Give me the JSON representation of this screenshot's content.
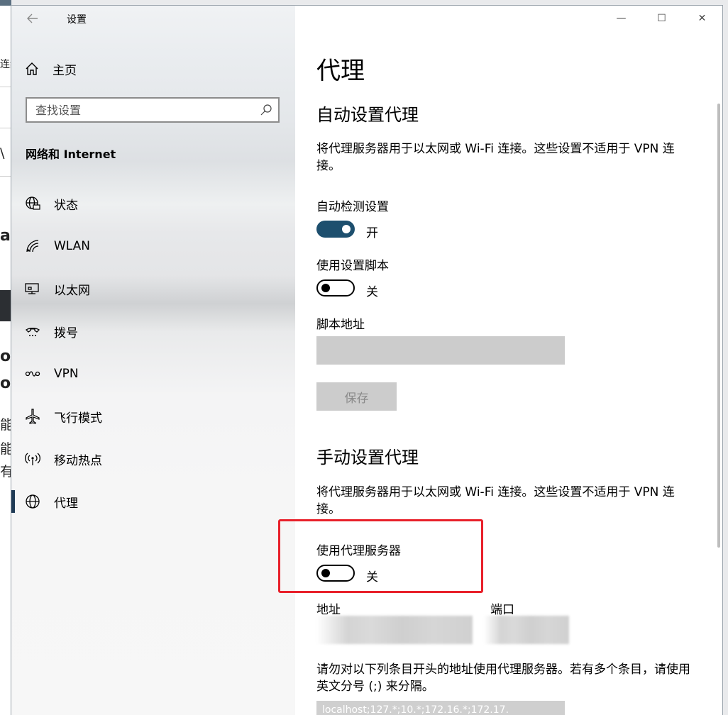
{
  "background": {
    "fragments": [
      "连续",
      "\\",
      "a",
      "or",
      "os",
      "能",
      "能",
      "有"
    ]
  },
  "window": {
    "title": "设置",
    "controls": {
      "minimize": "—",
      "maximize": "☐",
      "close": "✕"
    }
  },
  "sidebar": {
    "home_label": "主页",
    "search_placeholder": "查找设置",
    "section_title": "网络和 Internet",
    "items": [
      {
        "label": "状态",
        "icon": "globe-status-icon",
        "selected": false
      },
      {
        "label": "WLAN",
        "icon": "wifi-icon",
        "selected": false
      },
      {
        "label": "以太网",
        "icon": "ethernet-icon",
        "selected": false
      },
      {
        "label": "拨号",
        "icon": "dialup-icon",
        "selected": false
      },
      {
        "label": "VPN",
        "icon": "vpn-icon",
        "selected": false
      },
      {
        "label": "飞行模式",
        "icon": "airplane-icon",
        "selected": false
      },
      {
        "label": "移动热点",
        "icon": "hotspot-icon",
        "selected": false
      },
      {
        "label": "代理",
        "icon": "globe-icon",
        "selected": true
      }
    ]
  },
  "main": {
    "page_title": "代理",
    "auto": {
      "heading": "自动设置代理",
      "description": "将代理服务器用于以太网或 Wi-Fi 连接。这些设置不适用于 VPN 连接。",
      "detect_label": "自动检测设置",
      "detect_state": "开",
      "script_label": "使用设置脚本",
      "script_state": "关",
      "script_address_label": "脚本地址",
      "save_button": "保存"
    },
    "manual": {
      "heading": "手动设置代理",
      "description": "将代理服务器用于以太网或 Wi-Fi 连接。这些设置不适用于 VPN 连接。",
      "use_proxy_label": "使用代理服务器",
      "use_proxy_state": "关",
      "address_label": "地址",
      "port_label": "端口",
      "exceptions_description": "请勿对以下列条目开头的地址使用代理服务器。若有多个条目，请使用英文分号 (;) 来分隔。",
      "exceptions_value": "localhost;127.*;10.*;172.16.*;172.17."
    }
  },
  "colors": {
    "toggle_on": "#1d4f6e",
    "selection_bar": "#1f3a55",
    "highlight": "#e8202a",
    "disabled": "#cccccc"
  }
}
